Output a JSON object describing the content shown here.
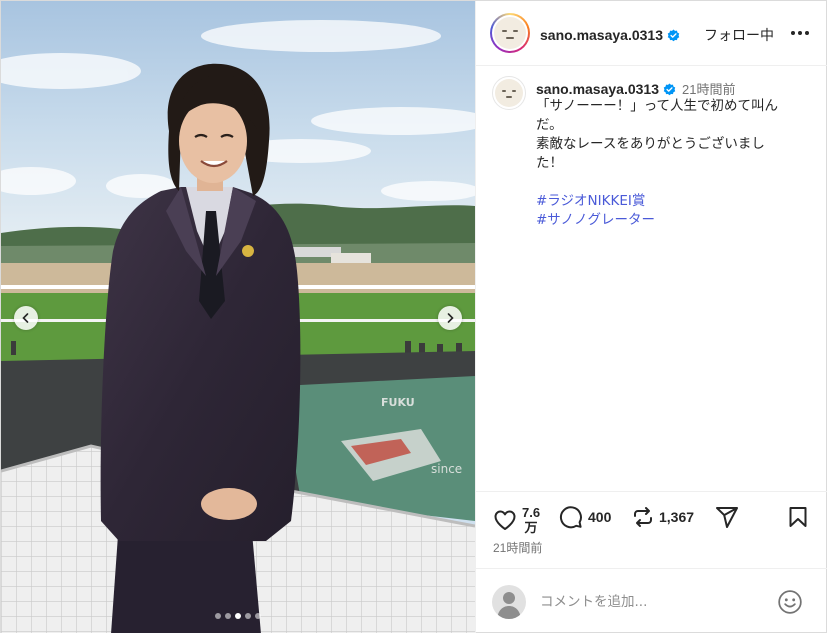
{
  "header": {
    "username": "sano.masaya.0313",
    "follow_status": "フォロー中",
    "more_icon": "more-horizontal-icon",
    "verified_color": "#0095f6"
  },
  "caption": {
    "username": "sano.masaya.0313",
    "time": "21時間前",
    "lines": [
      "「サノーーー！」って人生で初めて叫ん",
      "だ。",
      "素敵なレースをありがとうございまし",
      "た！"
    ],
    "hashtags": [
      "#ラジオNIKKEI賞",
      "#サノノグレーター"
    ]
  },
  "actions": {
    "likes": "7.6万",
    "likes_num": "7.6",
    "likes_unit": "万",
    "comments": "400",
    "reposts": "1,367",
    "posted": "21時間前",
    "icons": [
      "heart-icon",
      "comment-icon",
      "repost-icon",
      "share-icon",
      "bookmark-icon"
    ]
  },
  "comment_box": {
    "placeholder": "コメントを追加...",
    "emoji_icon": "smiley-icon"
  },
  "photo": {
    "slide_count": 5,
    "active_slide": 3,
    "signage": [
      "FUKU",
      "since"
    ]
  },
  "colors": {
    "hashtag": "#4a5ad8",
    "muted_text": "#737373",
    "border": "#efefef"
  }
}
